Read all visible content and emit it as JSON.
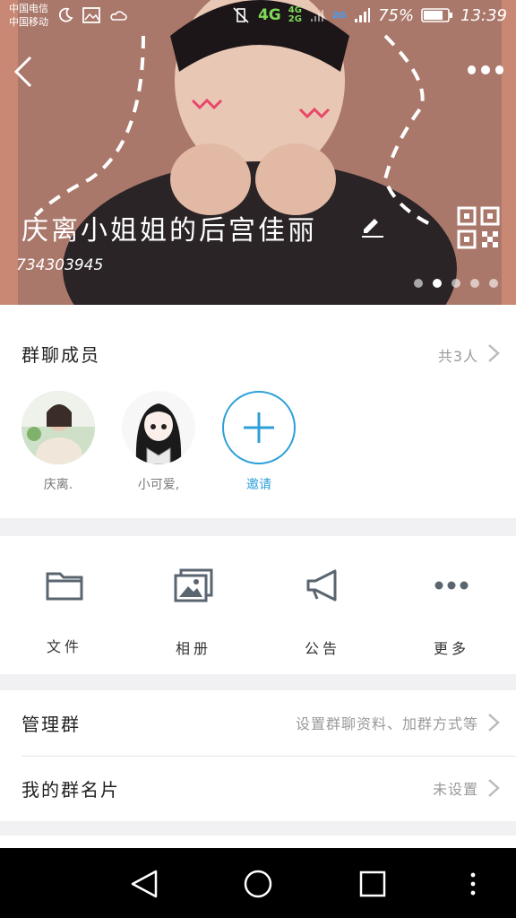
{
  "status_bar": {
    "carrier1": "中国电信",
    "carrier2": "中国移动",
    "network": "4G",
    "net_small_1": "4G",
    "net_small_2": "2G",
    "net_small_3": "2G",
    "battery": "75%",
    "time": "13:39"
  },
  "header": {
    "group_name": "庆离小姐姐的后宫佳丽",
    "group_id": "734303945",
    "carousel_pages": 5,
    "carousel_active": 2
  },
  "members": {
    "title": "群聊成员",
    "count": "共3人",
    "list": [
      {
        "name": "庆离."
      },
      {
        "name": "小可爱,"
      }
    ],
    "invite_label": "邀请"
  },
  "tools": [
    {
      "label": "文件",
      "icon": "folder-icon"
    },
    {
      "label": "相册",
      "icon": "photo-album-icon"
    },
    {
      "label": "公告",
      "icon": "megaphone-icon"
    },
    {
      "label": "更多",
      "icon": "more-dots-icon"
    }
  ],
  "rows": {
    "manage": {
      "title": "管理群",
      "value": "设置群聊资料、加群方式等"
    },
    "card": {
      "title": "我的群名片",
      "value": "未设置"
    }
  },
  "colors": {
    "accent": "#2d9fd9",
    "network_green": "#7ed957"
  }
}
